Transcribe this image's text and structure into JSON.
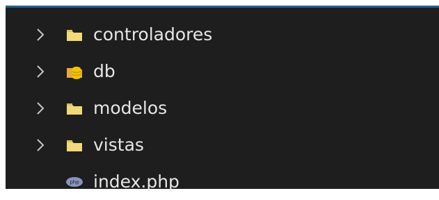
{
  "explorer": {
    "items": [
      {
        "label": "controladores",
        "type": "folder",
        "icon": "folder-icon",
        "collapsed": true
      },
      {
        "label": "db",
        "type": "folder",
        "icon": "database-folder-icon",
        "collapsed": true
      },
      {
        "label": "modelos",
        "type": "folder",
        "icon": "folder-icon",
        "collapsed": true
      },
      {
        "label": "vistas",
        "type": "folder",
        "icon": "folder-icon",
        "collapsed": true
      },
      {
        "label": "index.php",
        "type": "file",
        "icon": "php-file-icon"
      }
    ]
  },
  "colors": {
    "background": "#1e1e1e",
    "text": "#e6e6e6",
    "chevron": "#c5c5c5",
    "folder": "#f1d97b",
    "database": "#f2c400",
    "php": "#8993be",
    "accent_border": "#2a5f93"
  }
}
